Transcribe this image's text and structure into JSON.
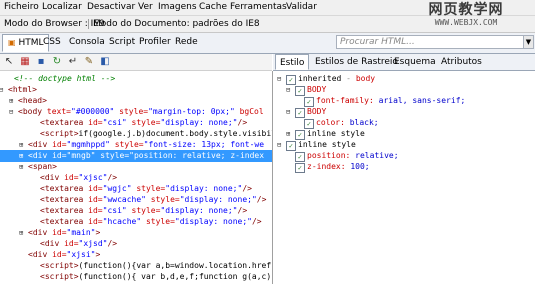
{
  "menu": [
    "Ficheiro",
    "Localizar",
    "Desactivar",
    "Ver",
    "Imagens",
    "Cache",
    "Ferramentas",
    "Validar"
  ],
  "mode_bar": {
    "browser_mode": "Modo do Browser : IE9",
    "document_mode": "Modo do Documento: padrões do IE8"
  },
  "watermark": {
    "line1": "网页教学网",
    "line2": "WWW.WEBJX.COM"
  },
  "tabs": [
    "HTML",
    "CSS",
    "Consola",
    "Script",
    "Profiler",
    "Rede"
  ],
  "search": {
    "placeholder": "Procurar HTML..."
  },
  "right_tabs": [
    "Estilo",
    "Estilos de Rastreio",
    "Esquema",
    "Atributos"
  ],
  "html_tree": [
    {
      "tog": "",
      "parts": [
        {
          "c": "cm",
          "t": "<!-- doctype html -->"
        }
      ]
    },
    {
      "tog": "−",
      "parts": [
        {
          "c": "t",
          "t": "<html>"
        }
      ]
    },
    {
      "tog": "+",
      "parts": [
        {
          "c": "t",
          "t": "<head>"
        }
      ]
    },
    {
      "tog": "−",
      "parts": [
        {
          "c": "t",
          "t": "<body "
        },
        {
          "c": "a",
          "t": "text="
        },
        {
          "c": "v",
          "t": "\"#000000\" "
        },
        {
          "c": "a",
          "t": "style="
        },
        {
          "c": "v",
          "t": "\"margin-top: 0px;\" "
        },
        {
          "c": "a",
          "t": "bgCol"
        }
      ]
    },
    {
      "tog": "",
      "parts": [
        {
          "c": "t",
          "t": "<textarea "
        },
        {
          "c": "a",
          "t": "id="
        },
        {
          "c": "v",
          "t": "\"csi\" "
        },
        {
          "c": "a",
          "t": "style="
        },
        {
          "c": "v",
          "t": "\"display: none;\""
        },
        {
          "c": "t",
          "t": "/>"
        }
      ]
    },
    {
      "tog": "",
      "parts": [
        {
          "c": "t",
          "t": "<script>"
        },
        {
          "c": "",
          "t": "if(google.j.b)document.body.style.visibil"
        }
      ]
    },
    {
      "tog": "+",
      "parts": [
        {
          "c": "t",
          "t": "<div "
        },
        {
          "c": "a",
          "t": "id="
        },
        {
          "c": "v",
          "t": "\"mgmhppd\" "
        },
        {
          "c": "a",
          "t": "style="
        },
        {
          "c": "v",
          "t": "\"font-size: 13px; font-we"
        }
      ]
    },
    {
      "tog": "+",
      "parts": [
        {
          "c": "t",
          "t": "<div "
        },
        {
          "c": "a",
          "t": "id="
        },
        {
          "c": "v",
          "t": "\"mngb\" "
        },
        {
          "c": "a",
          "t": "style="
        },
        {
          "c": "v",
          "t": "\"position: relative; z-index"
        }
      ],
      "selected": true
    },
    {
      "tog": "+",
      "parts": [
        {
          "c": "t",
          "t": "<span>"
        }
      ]
    },
    {
      "tog": "",
      "parts": [
        {
          "c": "t",
          "t": "<div "
        },
        {
          "c": "a",
          "t": "id="
        },
        {
          "c": "v",
          "t": "\"xjsc\""
        },
        {
          "c": "t",
          "t": "/>"
        }
      ]
    },
    {
      "tog": "",
      "parts": [
        {
          "c": "t",
          "t": "<textarea "
        },
        {
          "c": "a",
          "t": "id="
        },
        {
          "c": "v",
          "t": "\"wgjc\" "
        },
        {
          "c": "a",
          "t": "style="
        },
        {
          "c": "v",
          "t": "\"display: none;\""
        },
        {
          "c": "t",
          "t": "/>"
        }
      ]
    },
    {
      "tog": "",
      "parts": [
        {
          "c": "t",
          "t": "<textarea "
        },
        {
          "c": "a",
          "t": "id="
        },
        {
          "c": "v",
          "t": "\"wwcache\" "
        },
        {
          "c": "a",
          "t": "style="
        },
        {
          "c": "v",
          "t": "\"display: none;\""
        },
        {
          "c": "t",
          "t": "/>"
        }
      ]
    },
    {
      "tog": "",
      "parts": [
        {
          "c": "t",
          "t": "<textarea "
        },
        {
          "c": "a",
          "t": "id="
        },
        {
          "c": "v",
          "t": "\"csi\" "
        },
        {
          "c": "a",
          "t": "style="
        },
        {
          "c": "v",
          "t": "\"display: none;\""
        },
        {
          "c": "t",
          "t": "/>"
        }
      ]
    },
    {
      "tog": "",
      "parts": [
        {
          "c": "t",
          "t": "<textarea "
        },
        {
          "c": "a",
          "t": "id="
        },
        {
          "c": "v",
          "t": "\"hcache\" "
        },
        {
          "c": "a",
          "t": "style="
        },
        {
          "c": "v",
          "t": "\"display: none;\""
        },
        {
          "c": "t",
          "t": "/>"
        }
      ]
    },
    {
      "tog": "+",
      "parts": [
        {
          "c": "t",
          "t": "<div "
        },
        {
          "c": "a",
          "t": "id="
        },
        {
          "c": "v",
          "t": "\"main\""
        },
        {
          "c": "t",
          "t": ">"
        }
      ]
    },
    {
      "tog": "",
      "parts": [
        {
          "c": "t",
          "t": "<div "
        },
        {
          "c": "a",
          "t": "id="
        },
        {
          "c": "v",
          "t": "\"xjsd\""
        },
        {
          "c": "t",
          "t": "/>"
        }
      ]
    },
    {
      "tog": "",
      "parts": [
        {
          "c": "t",
          "t": "<div "
        },
        {
          "c": "a",
          "t": "id="
        },
        {
          "c": "v",
          "t": "\"xjsi\""
        },
        {
          "c": "t",
          "t": ">"
        }
      ]
    },
    {
      "tog": "",
      "parts": [
        {
          "c": "t",
          "t": "<script>"
        },
        {
          "c": "",
          "t": "(function(){var a,b=window.location.href."
        }
      ]
    },
    {
      "tog": "",
      "parts": [
        {
          "c": "t",
          "t": "<script>"
        },
        {
          "c": "",
          "t": "(function(){ var b,d,e,f;function g(a,c){"
        }
      ]
    }
  ],
  "style_tree": [
    {
      "level": 0,
      "tog": "−",
      "check": true,
      "parts": [
        {
          "c": "",
          "t": "inherited "
        },
        {
          "c": "dim",
          "t": "- "
        },
        {
          "c": "sel-name",
          "t": "body"
        }
      ]
    },
    {
      "level": 1,
      "tog": "−",
      "check": true,
      "parts": [
        {
          "c": "sel-name",
          "t": "BODY"
        }
      ]
    },
    {
      "level": 2,
      "tog": "",
      "check": true,
      "parts": [
        {
          "c": "prop",
          "t": "font-family: "
        },
        {
          "c": "val",
          "t": "arial, sans-serif;"
        }
      ]
    },
    {
      "level": 1,
      "tog": "−",
      "check": true,
      "parts": [
        {
          "c": "sel-name",
          "t": "BODY"
        }
      ]
    },
    {
      "level": 2,
      "tog": "",
      "check": true,
      "parts": [
        {
          "c": "prop",
          "t": "color: "
        },
        {
          "c": "val",
          "t": "black;"
        }
      ]
    },
    {
      "level": 1,
      "tog": "+",
      "check": true,
      "parts": [
        {
          "c": "",
          "t": "inline style"
        }
      ]
    },
    {
      "level": 0,
      "tog": "−",
      "check": true,
      "parts": [
        {
          "c": "",
          "t": "inline style"
        }
      ]
    },
    {
      "level": 1,
      "tog": "",
      "check": true,
      "parts": [
        {
          "c": "prop",
          "t": "position: "
        },
        {
          "c": "val",
          "t": "relative;"
        }
      ]
    },
    {
      "level": 1,
      "tog": "",
      "check": true,
      "parts": [
        {
          "c": "prop",
          "t": "z-index: "
        },
        {
          "c": "val",
          "t": "100;"
        }
      ]
    }
  ]
}
